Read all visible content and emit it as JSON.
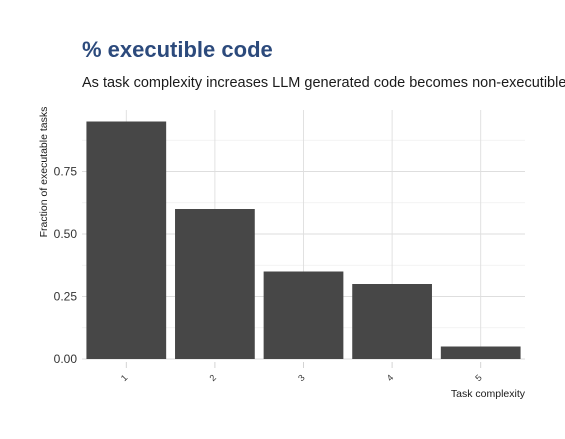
{
  "chart_data": {
    "type": "bar",
    "title": "% executible code",
    "subtitle": "As task complexity increases LLM generated code becomes non-executible",
    "xlabel": "Task complexity",
    "ylabel": "Fraction of executable tasks",
    "categories": [
      "1",
      "2",
      "3",
      "4",
      "5"
    ],
    "values": [
      0.95,
      0.6,
      0.35,
      0.3,
      0.05
    ],
    "ylim": [
      0,
      1.0
    ],
    "yticks": [
      0.0,
      0.25,
      0.5,
      0.75
    ],
    "ytick_labels": [
      "0.00",
      "0.25",
      "0.50",
      "0.75"
    ],
    "bar_color": "#474747",
    "title_color": "#2c4a7c",
    "grid": true,
    "legend": "none"
  }
}
